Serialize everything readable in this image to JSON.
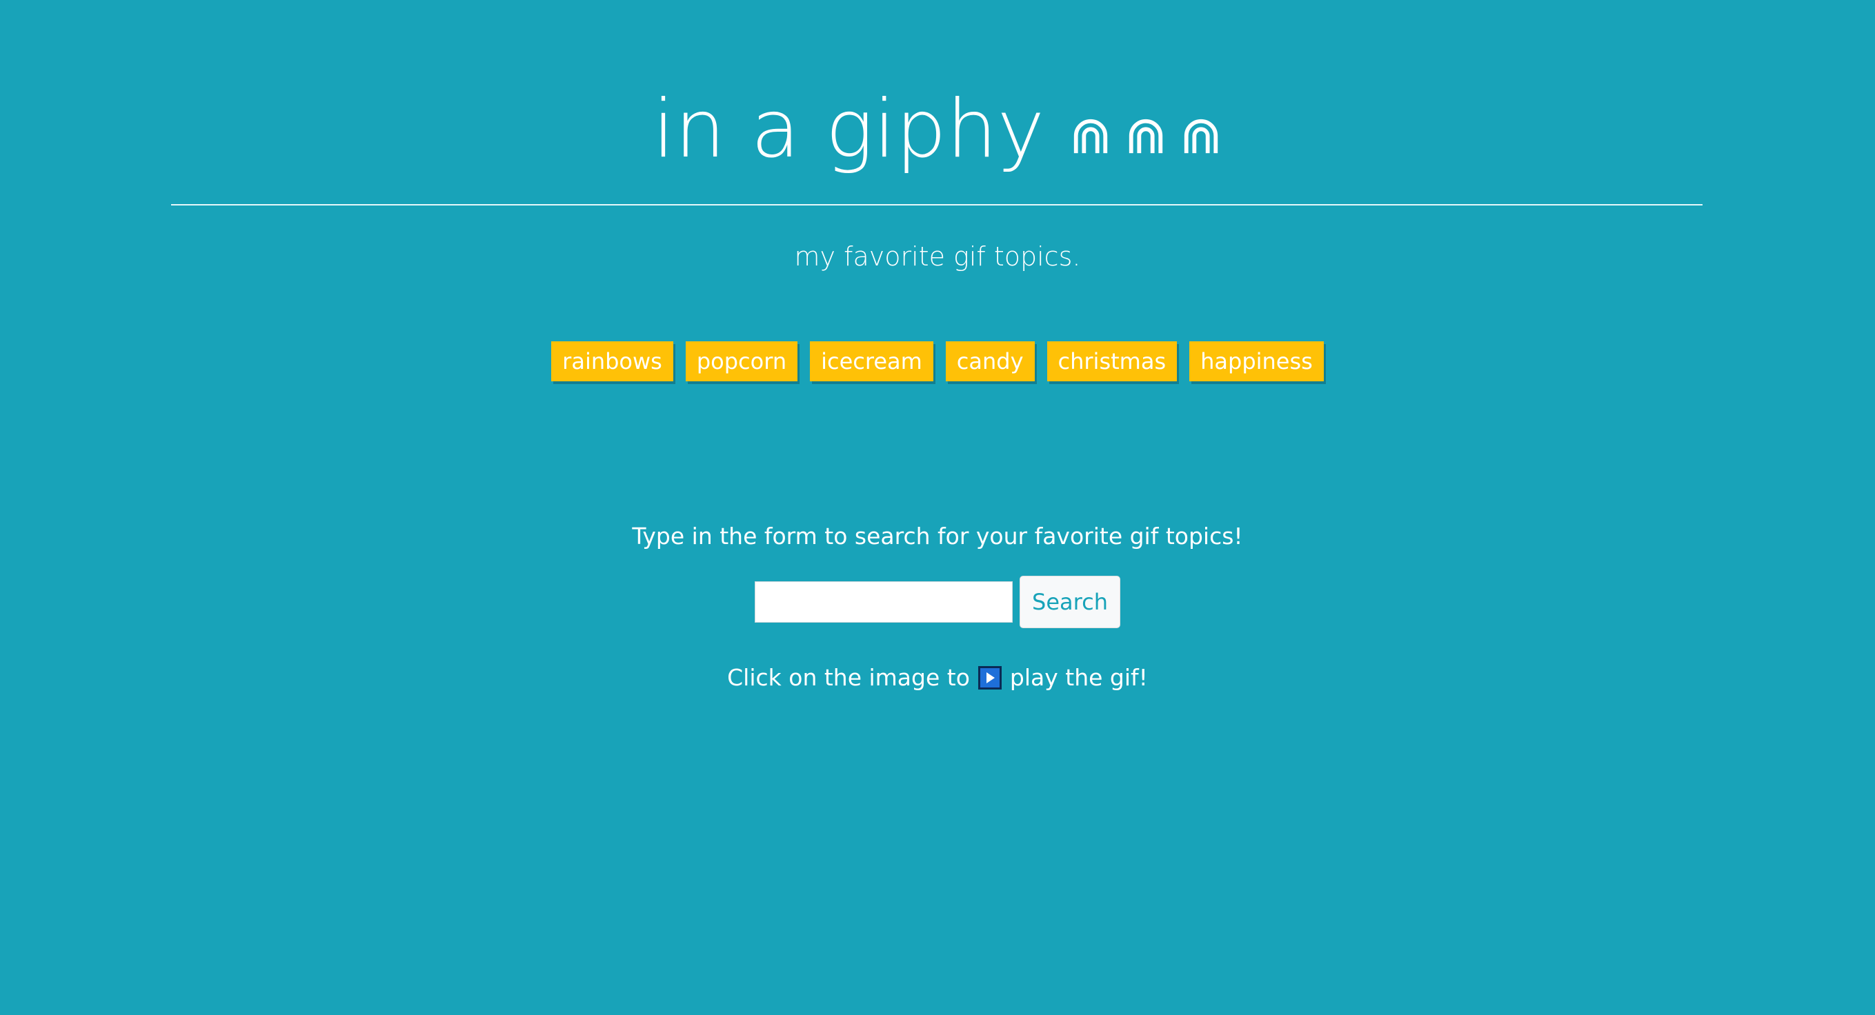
{
  "header": {
    "title": "in a giphy",
    "icons": [
      "rainbow-arc-icon",
      "rainbow-arc-icon",
      "rainbow-arc-icon"
    ]
  },
  "subtitle": "my favorite gif topics.",
  "topics": [
    {
      "label": "rainbows"
    },
    {
      "label": "popcorn"
    },
    {
      "label": "icecream"
    },
    {
      "label": "candy"
    },
    {
      "label": "christmas"
    },
    {
      "label": "happiness"
    }
  ],
  "search": {
    "instructions": "Type in the form to search for your favorite gif topics!",
    "value": "",
    "button_label": "Search"
  },
  "hint": {
    "before": "Click on the image to",
    "icon": "play-button-icon",
    "after": "play the gif!"
  },
  "colors": {
    "background": "#18a3b9",
    "topic_button": "#ffc107",
    "search_text": "#18a3b9"
  }
}
